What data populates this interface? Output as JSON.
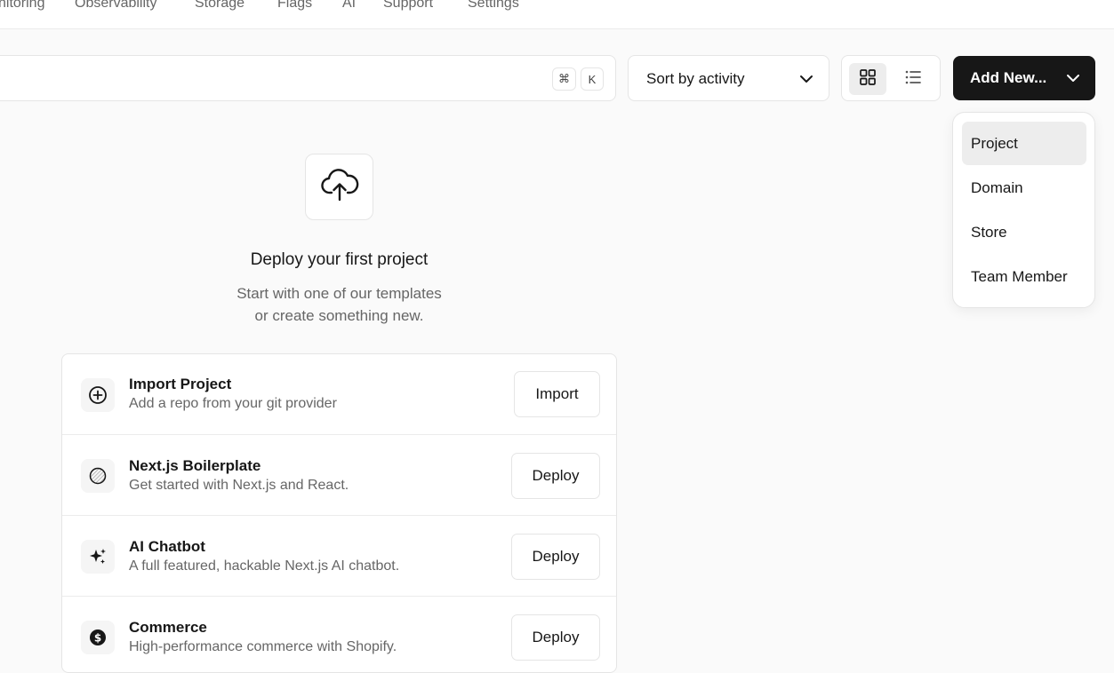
{
  "nav": {
    "items": [
      "nitoring",
      "Observability",
      "Storage",
      "Flags",
      "AI",
      "Support",
      "Settings"
    ]
  },
  "search": {
    "shortcut_keys": [
      "⌘",
      "K"
    ]
  },
  "toolbar": {
    "sort_label": "Sort by activity",
    "add_new_label": "Add New..."
  },
  "add_menu": {
    "items": [
      "Project",
      "Domain",
      "Store",
      "Team Member"
    ],
    "highlighted": "Project"
  },
  "empty_state": {
    "title": "Deploy your first project",
    "subtitle_line1": "Start with one of our templates",
    "subtitle_line2": "or create something new."
  },
  "templates": [
    {
      "title": "Import Project",
      "description": "Add a repo from your git provider",
      "action": "Import",
      "icon": "plus-circle-icon"
    },
    {
      "title": "Next.js Boilerplate",
      "description": "Get started with Next.js and React.",
      "action": "Deploy",
      "icon": "nextjs-logo-icon"
    },
    {
      "title": "AI Chatbot",
      "description": "A full featured, hackable Next.js AI chatbot.",
      "action": "Deploy",
      "icon": "sparkles-icon"
    },
    {
      "title": "Commerce",
      "description": "High-performance commerce with Shopify.",
      "action": "Deploy",
      "icon": "dollar-circle-icon"
    }
  ],
  "colors": {
    "primary_button": "#171717",
    "background": "#fafafa",
    "muted_text": "#666666",
    "border": "#e5e5e5"
  }
}
